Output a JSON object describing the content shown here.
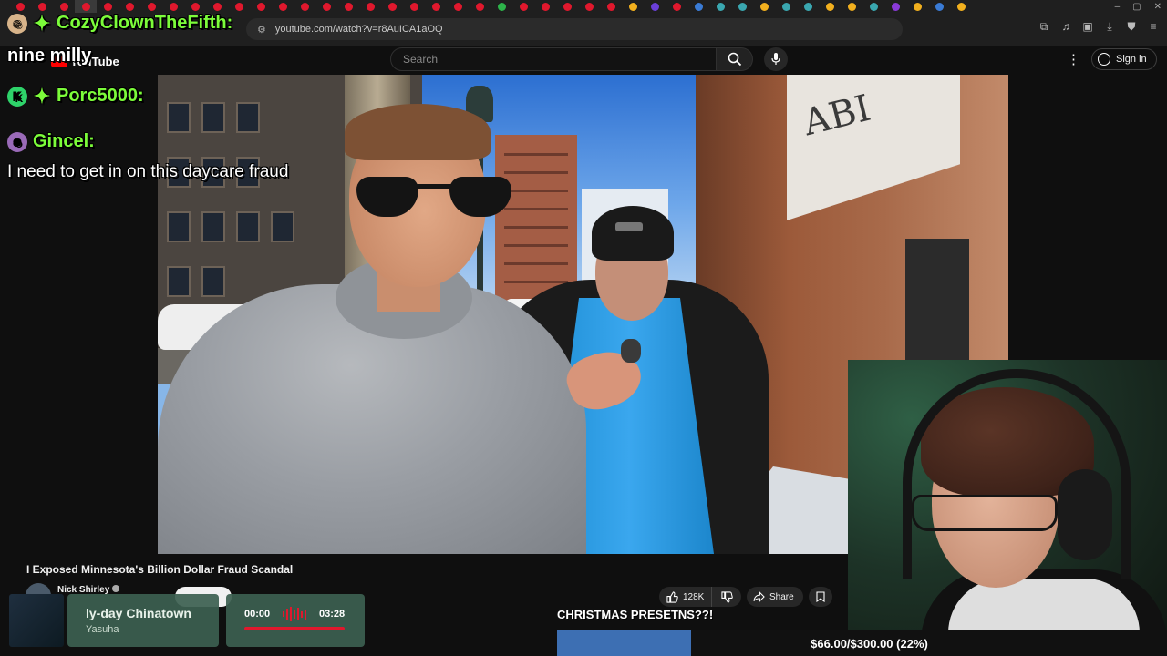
{
  "browser": {
    "url": "youtube.com/watch?v=r8AuICA1aOQ",
    "tab_colors": [
      "#e0182d",
      "#e0182d",
      "#e0182d",
      "#e0182d",
      "#e0182d",
      "#e0182d",
      "#e0182d",
      "#e0182d",
      "#e0182d",
      "#e0182d",
      "#e0182d",
      "#e0182d",
      "#e0182d",
      "#e0182d",
      "#e0182d",
      "#e0182d",
      "#e0182d",
      "#e0182d",
      "#e0182d",
      "#e0182d",
      "#e0182d",
      "#e0182d",
      "#2db34a",
      "#e0182d",
      "#e0182d",
      "#e0182d",
      "#e0182d",
      "#e0182d",
      "#f2b01e",
      "#6a3fd8",
      "#e0182d",
      "#3a7bd5",
      "#3aa7b0",
      "#3aa7b0",
      "#f2b01e",
      "#3aa7b0",
      "#3aa7b0",
      "#f2b01e",
      "#f2b01e",
      "#3aa7b0",
      "#8a3ad8",
      "#f2b01e",
      "#3a7bd5",
      "#f2b01e"
    ]
  },
  "youtube": {
    "logo_text": "YouTube",
    "search_placeholder": "Search",
    "sign_in_label": "Sign in",
    "video_title": "I Exposed Minnesota's Billion Dollar Fraud Scandal",
    "channel_name": "Nick Shirley",
    "like_count": "128K",
    "share_label": "Share",
    "accent_color": "#ff0000"
  },
  "chat": {
    "messages": [
      {
        "user": "CozyClownTheFifth:",
        "text": "nine milly"
      },
      {
        "user": "Porc5000:",
        "badge": "K",
        "text": ""
      },
      {
        "user": "Gincel:",
        "text": "I need to get in on this daycare fraud"
      }
    ],
    "username_color": "#7cfc3a"
  },
  "music": {
    "song": "ly-day Chinatown",
    "artist": "Yasuha",
    "current_time": "00:00",
    "total_time": "03:28"
  },
  "goal": {
    "label": "CHRISTMAS PRESETNS??!",
    "text": "$66.00/$300.00 (22%)",
    "fraction": 0.22,
    "fill_color": "#3d6fb3"
  },
  "video_scene": {
    "store_sign": "ABI"
  }
}
